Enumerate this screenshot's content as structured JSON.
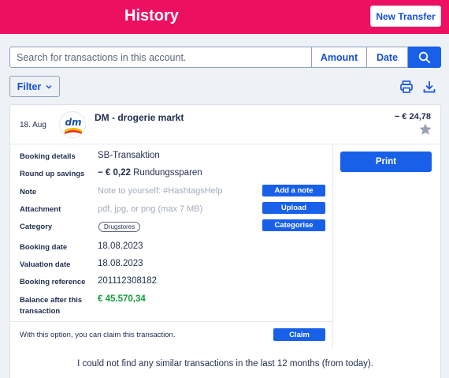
{
  "header": {
    "title": "History",
    "new_transfer_label": "New Transfer"
  },
  "search": {
    "placeholder": "Search for transactions in this account.",
    "amount_label": "Amount",
    "date_label": "Date"
  },
  "toolbar": {
    "filter_label": "Filter"
  },
  "transaction": {
    "date": "18. Aug",
    "merchant": "DM - drogerie markt",
    "logo_text": "dm",
    "amount": "− € 24,78",
    "details": {
      "booking_details_label": "Booking details",
      "booking_details_value": "SB-Transaktion",
      "round_up_label": "Round up savings",
      "round_up_amount": "− € 0,22",
      "round_up_text": "Rundungssparen",
      "note_label": "Note",
      "note_placeholder": "Note to yourself: #HashtagsHelp",
      "add_note_label": "Add a note",
      "attachment_label": "Attachment",
      "attachment_placeholder": "pdf, jpg, or png (max 7 MB)",
      "upload_label": "Upload",
      "category_label": "Category",
      "category_value": "Drugstores",
      "categorise_label": "Categorise",
      "booking_date_label": "Booking date",
      "booking_date_value": "18.08.2023",
      "valuation_date_label": "Valuation date",
      "valuation_date_value": "18.08.2023",
      "booking_reference_label": "Booking reference",
      "booking_reference_value": "201112308182",
      "balance_label_line1": "Balance after this",
      "balance_label_line2": "transaction",
      "balance_value": "€ 45.570,34"
    },
    "print_label": "Print",
    "claim_text": "With this option, you can claim this transaction.",
    "claim_label": "Claim"
  },
  "similar_text": "I could not find any similar transactions in the last 12 months (from today).",
  "colors": {
    "brand": "#ec0f62",
    "accent": "#1860e8",
    "positive": "#12a039"
  },
  "icons": [
    "search-icon",
    "chevron-down-icon",
    "print-icon",
    "download-icon",
    "star-icon"
  ]
}
